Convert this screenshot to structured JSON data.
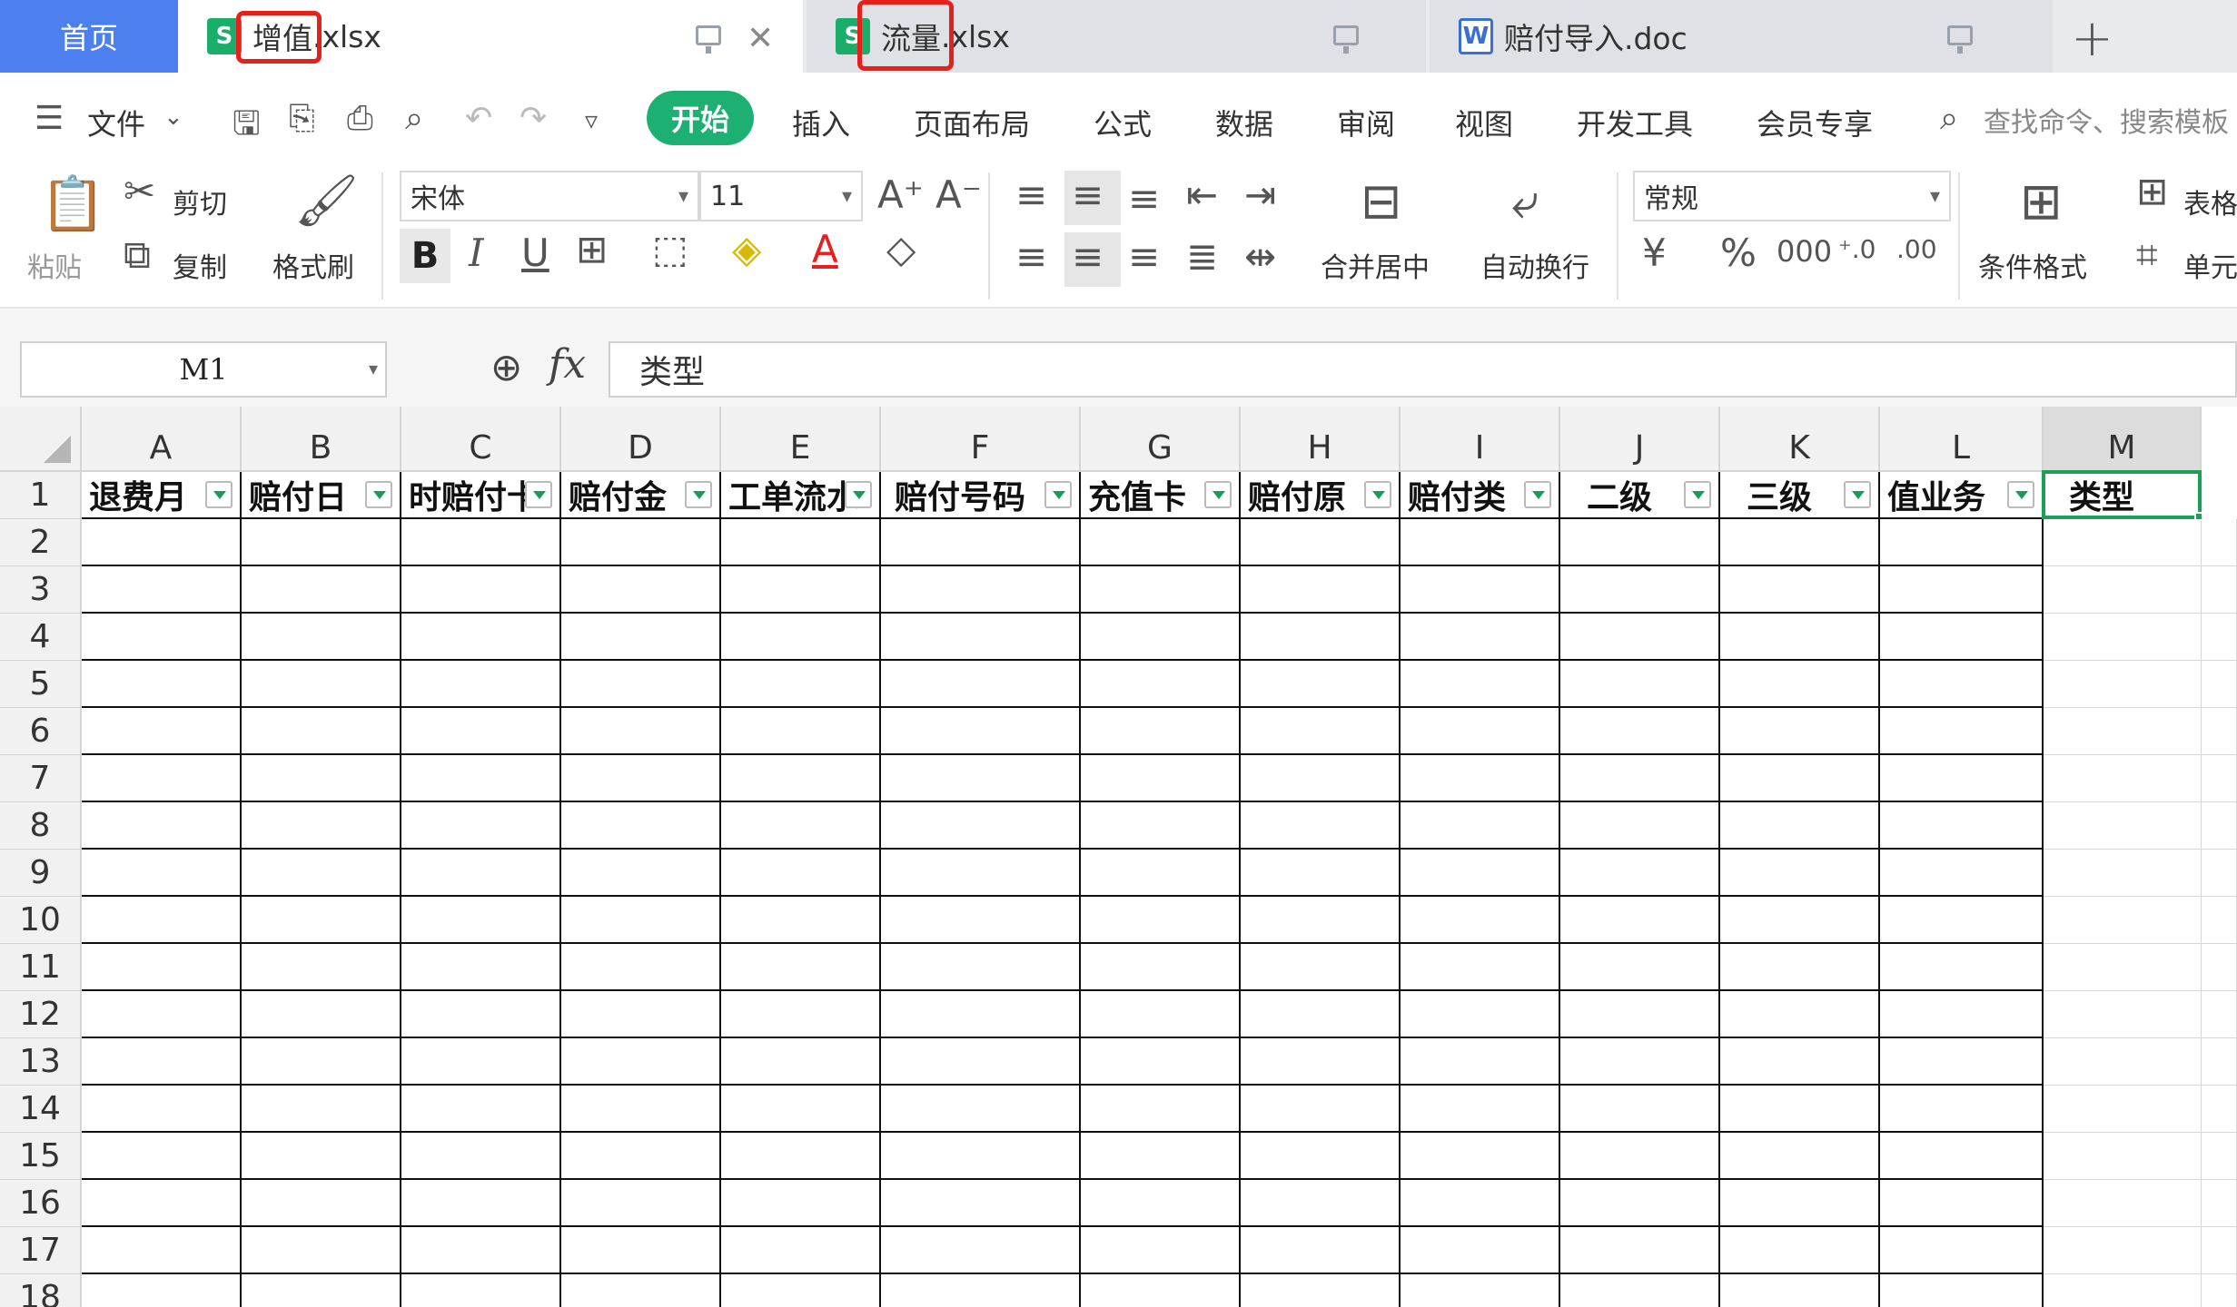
{
  "tabs": {
    "home": "首页",
    "items": [
      {
        "name": "增值.xlsx",
        "highlight": "增值",
        "rest": "xlsx",
        "type": "xlsx",
        "active": true
      },
      {
        "name": "流量.xlsx",
        "highlight": "流量",
        "rest": "xlsx",
        "type": "xlsx",
        "active": false
      },
      {
        "name": "赔付导入.doc",
        "type": "doc",
        "active": false
      }
    ],
    "new_tab": "+"
  },
  "menu": {
    "file": "文件",
    "items": [
      "开始",
      "插入",
      "页面布局",
      "公式",
      "数据",
      "审阅",
      "视图",
      "开发工具",
      "会员专享"
    ],
    "active": "开始",
    "search_placeholder": "查找命令、搜索模板"
  },
  "ribbon": {
    "paste": "粘贴",
    "cut": "剪切",
    "copy": "复制",
    "format_painter": "格式刷",
    "font_name": "宋体",
    "font_size": "11",
    "merge_center": "合并居中",
    "wrap_text": "自动换行",
    "number_format": "常规",
    "conditional_format": "条件格式",
    "table_style": "表格",
    "cell": "单元"
  },
  "formula_bar": {
    "cell_ref": "M1",
    "fx": "fx",
    "value": "类型"
  },
  "sheet": {
    "columns": [
      "A",
      "B",
      "C",
      "D",
      "E",
      "F",
      "G",
      "H",
      "I",
      "J",
      "K",
      "L",
      "M"
    ],
    "selected_column": "M",
    "rows": [
      "1",
      "2",
      "3",
      "4",
      "5",
      "6",
      "7",
      "8",
      "9",
      "10",
      "11",
      "12",
      "13",
      "14",
      "15",
      "16",
      "17",
      "18"
    ],
    "header_row": [
      "退费月",
      "赔付日",
      "时赔付卡",
      "赔付金",
      "工单流水",
      "赔付号码",
      "充值卡",
      "赔付原",
      "赔付类",
      "二级",
      "三级",
      "值业务",
      "类型"
    ],
    "active_cell": "M1"
  },
  "colors": {
    "home_tab": "#4c80ee",
    "accent_green": "#1db073",
    "highlight_red": "#e6211c"
  }
}
